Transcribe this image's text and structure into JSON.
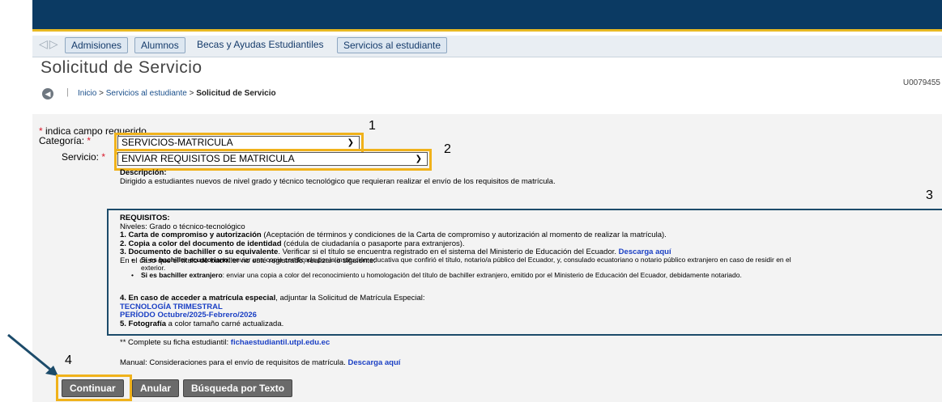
{
  "tabs": [
    "Admisiones",
    "Alumnos",
    "Becas y Ayudas Estudiantiles",
    "Servicios al estudiante"
  ],
  "page_title": "Solicitud de Servicio",
  "user_id": "U0079455",
  "breadcrumb": {
    "home": "Inicio",
    "section": "Servicios al estudiante",
    "current": "Solicitud de Servicio",
    "sep": ">"
  },
  "form": {
    "required_hint": "indica campo requerido",
    "category_label": "Categoría:",
    "category_value": "SERVICIOS-MATRICULA",
    "service_label": "Servicio:",
    "service_value": "ENVIAR REQUISITOS DE MATRICULA",
    "description_label": "Descripción:",
    "description_text": "Dirigido a estudiantes nuevos de nivel grado y técnico tecnológico que requieran realizar el envío de los requisitos de matrícula."
  },
  "requirements": {
    "heading": "REQUISITOS:",
    "levels": "Niveles: Grado o técnico-tecnológico",
    "item1_bold": "1. Carta de compromiso y autorización",
    "item1_rest": " (Aceptación de términos y condiciones de la Carta de compromiso y autorización al momento de realizar la matrícula).",
    "item2_bold": "2. Copia a color del documento de identidad",
    "item2_rest": " (cédula de ciudadanía o pasaporte para extranjeros).",
    "item3_bold": "3. Documento de bachiller o su equivalente",
    "item3_rest": ". Verificar si el título se encuentra registrado en el sistema del Ministerio de Educación del Ecuador.",
    "download_link": "Descarga aquí",
    "not_registered": "En el caso que el título de bachiller no esté registrado; realizar lo siguiente:",
    "bullet1_bold": "Si es bachiller ecuatoriano",
    "bullet1_rest": ": enviar una copia certificada por la institución educativa que confirió el título, notario/a público del Ecuador, y, consulado ecuatoriano o notario público extranjero en caso de residir en el",
    "bullet1_cont": "exterior.",
    "bullet2_bold": "Si es bachiller extranjero",
    "bullet2_rest": ": enviar una copia a color del reconocimiento u homologación del título de bachiller extranjero, emitido por el Ministerio de Educación del Ecuador, debidamente notariado.",
    "item4_a": "4. En caso de acceder a ",
    "item4_b": "matrícula especial",
    "item4_c": ", adjuntar la Solicitud de Matrícula Especial:",
    "link_tecno": "TECNOLOGÍA TRIMESTRAL",
    "link_periodo": "PERÍODO Octubre/2025-Febrero/2026",
    "item5_bold": "5. Fotografía",
    "item5_rest": " a color tamaño carné actualizada."
  },
  "footer": {
    "ficha_prefix": "** Complete su ficha estudiantil:",
    "ficha_link": "fichaestudiantil.utpl.edu.ec",
    "manual_text": "Manual: Consideraciones para el envío de requisitos de matrícula.",
    "manual_link": "Descarga aquí"
  },
  "buttons": {
    "continue": "Continuar",
    "cancel": "Anular",
    "search": "Búsqueda por Texto"
  },
  "annotations": {
    "n1": "1",
    "n2": "2",
    "n3": "3",
    "n4": "4"
  },
  "colors": {
    "header": "#0b3a63",
    "highlight": "#f0b21b",
    "box": "#1c4b6a",
    "link": "#1a3fc4"
  }
}
